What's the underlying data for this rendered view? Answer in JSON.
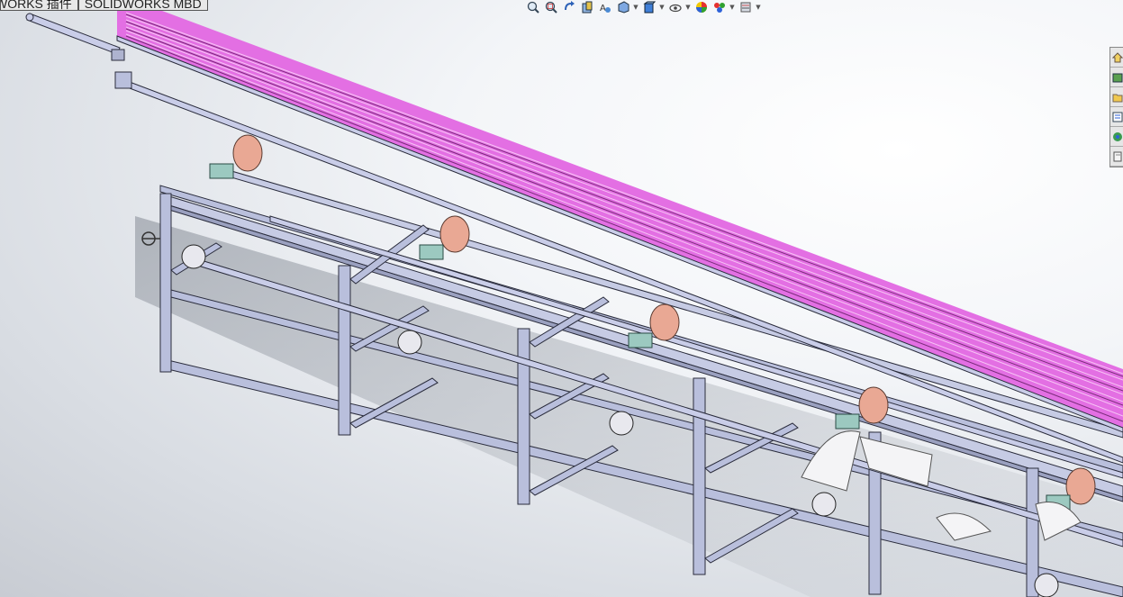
{
  "document_tabs": [
    {
      "label": "WORKS 插件"
    },
    {
      "label": "SOLIDWORKS MBD"
    }
  ],
  "heads_up_toolbar": [
    {
      "name": "zoom-to-fit-icon",
      "has_menu": false
    },
    {
      "name": "zoom-to-area-icon",
      "has_menu": false
    },
    {
      "name": "previous-view-icon",
      "has_menu": false
    },
    {
      "name": "section-view-icon",
      "has_menu": false
    },
    {
      "name": "dynamic-annotation-icon",
      "has_menu": false
    },
    {
      "name": "view-orientation-icon",
      "has_menu": true
    },
    {
      "name": "display-style-icon",
      "has_menu": true
    },
    {
      "name": "hide-show-items-icon",
      "has_menu": true
    },
    {
      "name": "edit-appearance-icon",
      "has_menu": false
    },
    {
      "name": "apply-scene-icon",
      "has_menu": true
    },
    {
      "name": "view-settings-icon",
      "has_menu": true
    }
  ],
  "task_pane": [
    {
      "name": "home-icon"
    },
    {
      "name": "design-library-icon"
    },
    {
      "name": "file-explorer-icon"
    },
    {
      "name": "view-palette-icon"
    },
    {
      "name": "appearances-icon"
    },
    {
      "name": "custom-properties-icon"
    }
  ],
  "colors": {
    "frame": "#b9bfdc",
    "frame_edge": "#2a2c3c",
    "rods": "#e36fe3",
    "pulley": "#e9a894",
    "bearing_block": "#9cc9c0",
    "viewport_background": "#f3f5f8"
  }
}
